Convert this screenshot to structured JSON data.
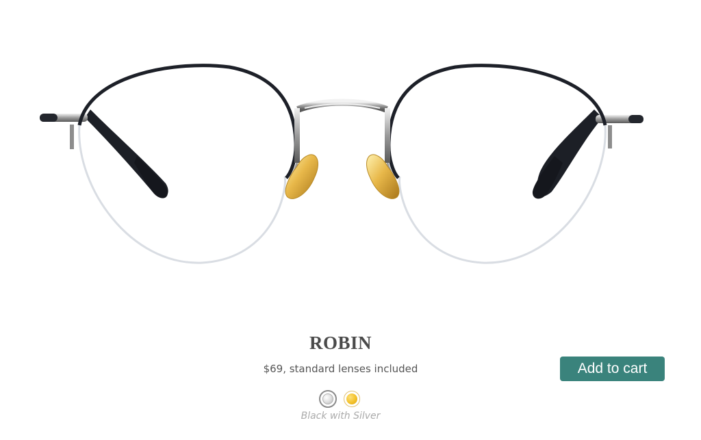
{
  "product": {
    "name": "ROBIN",
    "price_text": "$69, standard lenses included",
    "image_icon": "eyeglasses-image"
  },
  "cart": {
    "button_label": "Add to cart",
    "button_color": "#3a837c"
  },
  "colors": {
    "selected_label": "Black with Silver",
    "options": [
      {
        "name": "silver-swatch",
        "swatch_color": "#d9d9d9",
        "selected": true
      },
      {
        "name": "gold-swatch",
        "swatch_color": "#f3c12a",
        "selected": false
      }
    ]
  }
}
